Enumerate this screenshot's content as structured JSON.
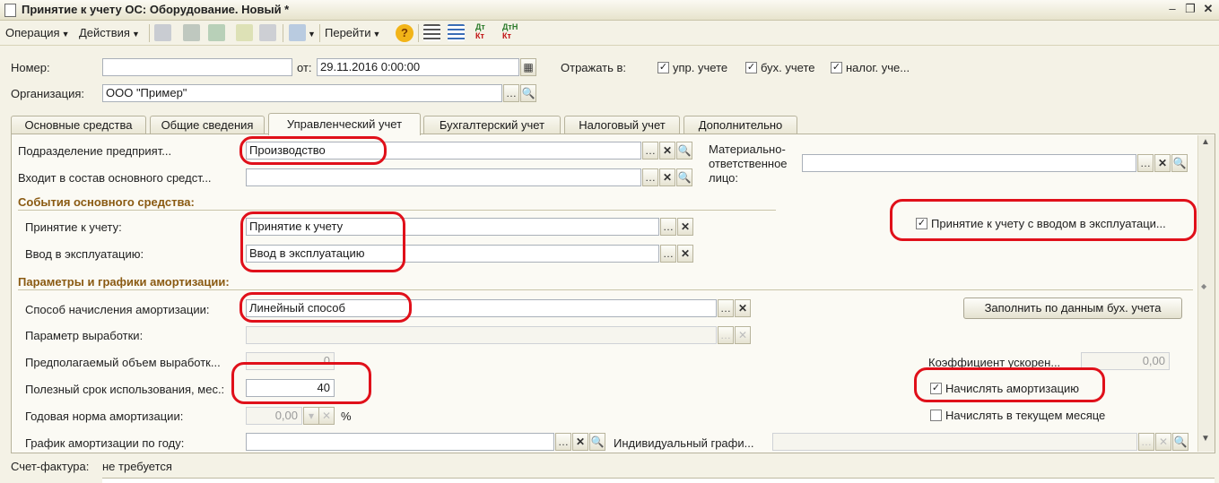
{
  "window": {
    "title": "Принятие к учету ОС: Оборудование. Новый *"
  },
  "toolbar": {
    "operation": "Операция",
    "actions": "Действия",
    "goto": "Перейти",
    "help": "?",
    "dt_kt": "Дт Кт",
    "dt_n_kt": "ДтН Кт"
  },
  "header": {
    "number_label": "Номер:",
    "number_value": "",
    "date_label": "от:",
    "date_value": "29.11.2016  0:00:00",
    "reflect_label": "Отражать в:",
    "reflect_mgmt": "упр. учете",
    "reflect_acc": "бух. учете",
    "reflect_tax": "налог. уче...",
    "org_label": "Организация:",
    "org_value": "ООО \"Пример\""
  },
  "tabs": [
    "Основные средства",
    "Общие сведения",
    "Управленческий учет",
    "Бухгалтерский учет",
    "Налоговый учет",
    "Дополнительно"
  ],
  "panel": {
    "dept_label": "Подразделение предприят...",
    "dept_value": "Производство",
    "part_of_label": "Входит в состав основного средст...",
    "part_of_value": "",
    "mol_label_1": "Материально-",
    "mol_label_2": "ответственное",
    "mol_label_3": "лицо:",
    "mol_value": "",
    "events_title": "События основного средства:",
    "accept_label": "Принятие к учету:",
    "accept_value": "Принятие к учету",
    "commission_label": "Ввод в эксплуатацию:",
    "commission_value": "Ввод в эксплуатацию",
    "accept_with_commission": "Принятие к учету с вводом в эксплуатаци...",
    "amort_title": "Параметры и графики амортизации:",
    "method_label": "Способ начисления амортизации:",
    "method_value": "Линейный способ",
    "fill_button": "Заполнить по данным бух. учета",
    "production_param_label": "Параметр выработки:",
    "expected_volume_label": "Предполагаемый объем выработк...",
    "expected_volume_value": "0",
    "accel_coef_label": "Коэффициент ускорен...",
    "accel_coef_value": "0,00",
    "useful_life_label": "Полезный срок использования, мес.:",
    "useful_life_value": "40",
    "charge_amort": "Начислять амортизацию",
    "annual_rate_label": "Годовая норма амортизации:",
    "annual_rate_value": "0,00",
    "percent": "%",
    "charge_current_month": "Начислять в текущем месяце",
    "schedule_label": "График амортизации по году:",
    "schedule_value": "",
    "individual_label": "Индивидуальный графи...",
    "individual_value": ""
  },
  "footer": {
    "invoice_label": "Счет-фактура:",
    "invoice_value": "не требуется"
  },
  "colors": {
    "highlight": "#e0101a",
    "section": "#8a5a12"
  }
}
